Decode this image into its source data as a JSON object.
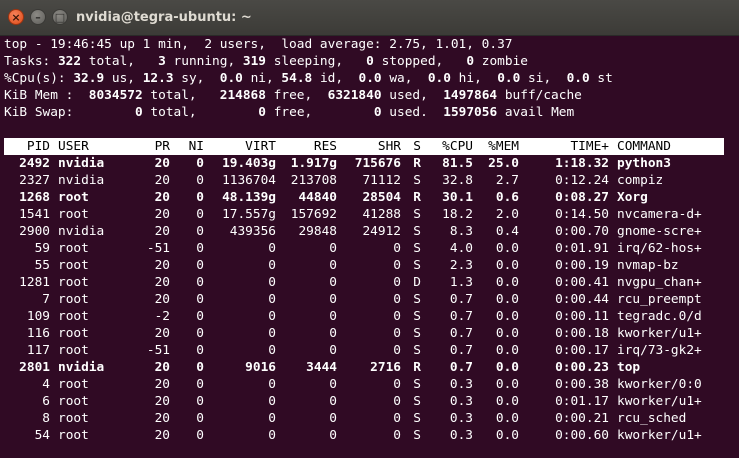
{
  "window": {
    "title": "nvidia@tegra-ubuntu: ~",
    "close_glyph": "×",
    "min_glyph": "–",
    "max_glyph": "□"
  },
  "colors": {
    "terminal_bg": "#300a24",
    "terminal_fg": "#ffffff",
    "close_button": "#df4a16"
  },
  "summary": {
    "line1": "top - 19:46:45 up 1 min,  2 users,  load average: 2.75, 1.01, 0.37",
    "tasks": [
      {
        "t": "Tasks: ",
        "b": false
      },
      {
        "t": "322",
        "b": true
      },
      {
        "t": " total,   ",
        "b": false
      },
      {
        "t": "3",
        "b": true
      },
      {
        "t": " running, ",
        "b": false
      },
      {
        "t": "319",
        "b": true
      },
      {
        "t": " sleeping,   ",
        "b": false
      },
      {
        "t": "0",
        "b": true
      },
      {
        "t": " stopped,   ",
        "b": false
      },
      {
        "t": "0",
        "b": true
      },
      {
        "t": " zombie",
        "b": false
      }
    ],
    "cpu": [
      {
        "t": "%Cpu(s): ",
        "b": false
      },
      {
        "t": "32.9",
        "b": true
      },
      {
        "t": " us, ",
        "b": false
      },
      {
        "t": "12.3",
        "b": true
      },
      {
        "t": " sy,  ",
        "b": false
      },
      {
        "t": "0.0",
        "b": true
      },
      {
        "t": " ni, ",
        "b": false
      },
      {
        "t": "54.8",
        "b": true
      },
      {
        "t": " id,  ",
        "b": false
      },
      {
        "t": "0.0",
        "b": true
      },
      {
        "t": " wa,  ",
        "b": false
      },
      {
        "t": "0.0",
        "b": true
      },
      {
        "t": " hi,  ",
        "b": false
      },
      {
        "t": "0.0",
        "b": true
      },
      {
        "t": " si,  ",
        "b": false
      },
      {
        "t": "0.0",
        "b": true
      },
      {
        "t": " st",
        "b": false
      }
    ],
    "mem": [
      {
        "t": "KiB Mem :  ",
        "b": false
      },
      {
        "t": "8034572",
        "b": true
      },
      {
        "t": " total,   ",
        "b": false
      },
      {
        "t": "214868",
        "b": true
      },
      {
        "t": " free,  ",
        "b": false
      },
      {
        "t": "6321840",
        "b": true
      },
      {
        "t": " used,  ",
        "b": false
      },
      {
        "t": "1497864",
        "b": true
      },
      {
        "t": " buff/cache",
        "b": false
      }
    ],
    "swap": [
      {
        "t": "KiB Swap:        ",
        "b": false
      },
      {
        "t": "0",
        "b": true
      },
      {
        "t": " total,        ",
        "b": false
      },
      {
        "t": "0",
        "b": true
      },
      {
        "t": " free,        ",
        "b": false
      },
      {
        "t": "0",
        "b": true
      },
      {
        "t": " used.  ",
        "b": false
      },
      {
        "t": "1597056",
        "b": true
      },
      {
        "t": " avail Mem",
        "b": false
      }
    ]
  },
  "columns": [
    "PID",
    "USER",
    "PR",
    "NI",
    "VIRT",
    "RES",
    "SHR",
    "S",
    "%CPU",
    "%MEM",
    "TIME+",
    "COMMAND"
  ],
  "processes": [
    {
      "pid": "2492",
      "user": "nvidia",
      "pr": "20",
      "ni": "0",
      "virt": "19.403g",
      "res": "1.917g",
      "shr": "715676",
      "s": "R",
      "cpu": "81.5",
      "mem": "25.0",
      "time": "1:18.32",
      "cmd": "python3",
      "bold": true
    },
    {
      "pid": "2327",
      "user": "nvidia",
      "pr": "20",
      "ni": "0",
      "virt": "1136704",
      "res": "213708",
      "shr": "71112",
      "s": "S",
      "cpu": "32.8",
      "mem": "2.7",
      "time": "0:12.24",
      "cmd": "compiz",
      "bold": false
    },
    {
      "pid": "1268",
      "user": "root",
      "pr": "20",
      "ni": "0",
      "virt": "48.139g",
      "res": "44840",
      "shr": "28504",
      "s": "R",
      "cpu": "30.1",
      "mem": "0.6",
      "time": "0:08.27",
      "cmd": "Xorg",
      "bold": true
    },
    {
      "pid": "1541",
      "user": "root",
      "pr": "20",
      "ni": "0",
      "virt": "17.557g",
      "res": "157692",
      "shr": "41288",
      "s": "S",
      "cpu": "18.2",
      "mem": "2.0",
      "time": "0:14.50",
      "cmd": "nvcamera-d+",
      "bold": false
    },
    {
      "pid": "2900",
      "user": "nvidia",
      "pr": "20",
      "ni": "0",
      "virt": "439356",
      "res": "29848",
      "shr": "24912",
      "s": "S",
      "cpu": "8.3",
      "mem": "0.4",
      "time": "0:00.70",
      "cmd": "gnome-scre+",
      "bold": false
    },
    {
      "pid": "59",
      "user": "root",
      "pr": "-51",
      "ni": "0",
      "virt": "0",
      "res": "0",
      "shr": "0",
      "s": "S",
      "cpu": "4.0",
      "mem": "0.0",
      "time": "0:01.91",
      "cmd": "irq/62-hos+",
      "bold": false
    },
    {
      "pid": "55",
      "user": "root",
      "pr": "20",
      "ni": "0",
      "virt": "0",
      "res": "0",
      "shr": "0",
      "s": "S",
      "cpu": "2.3",
      "mem": "0.0",
      "time": "0:00.19",
      "cmd": "nvmap-bz",
      "bold": false
    },
    {
      "pid": "1281",
      "user": "root",
      "pr": "20",
      "ni": "0",
      "virt": "0",
      "res": "0",
      "shr": "0",
      "s": "D",
      "cpu": "1.3",
      "mem": "0.0",
      "time": "0:00.41",
      "cmd": "nvgpu_chan+",
      "bold": false
    },
    {
      "pid": "7",
      "user": "root",
      "pr": "20",
      "ni": "0",
      "virt": "0",
      "res": "0",
      "shr": "0",
      "s": "S",
      "cpu": "0.7",
      "mem": "0.0",
      "time": "0:00.44",
      "cmd": "rcu_preempt",
      "bold": false
    },
    {
      "pid": "109",
      "user": "root",
      "pr": "-2",
      "ni": "0",
      "virt": "0",
      "res": "0",
      "shr": "0",
      "s": "S",
      "cpu": "0.7",
      "mem": "0.0",
      "time": "0:00.11",
      "cmd": "tegradc.0/d",
      "bold": false
    },
    {
      "pid": "116",
      "user": "root",
      "pr": "20",
      "ni": "0",
      "virt": "0",
      "res": "0",
      "shr": "0",
      "s": "S",
      "cpu": "0.7",
      "mem": "0.0",
      "time": "0:00.18",
      "cmd": "kworker/u1+",
      "bold": false
    },
    {
      "pid": "117",
      "user": "root",
      "pr": "-51",
      "ni": "0",
      "virt": "0",
      "res": "0",
      "shr": "0",
      "s": "S",
      "cpu": "0.7",
      "mem": "0.0",
      "time": "0:00.17",
      "cmd": "irq/73-gk2+",
      "bold": false
    },
    {
      "pid": "2801",
      "user": "nvidia",
      "pr": "20",
      "ni": "0",
      "virt": "9016",
      "res": "3444",
      "shr": "2716",
      "s": "R",
      "cpu": "0.7",
      "mem": "0.0",
      "time": "0:00.23",
      "cmd": "top",
      "bold": true
    },
    {
      "pid": "4",
      "user": "root",
      "pr": "20",
      "ni": "0",
      "virt": "0",
      "res": "0",
      "shr": "0",
      "s": "S",
      "cpu": "0.3",
      "mem": "0.0",
      "time": "0:00.38",
      "cmd": "kworker/0:0",
      "bold": false
    },
    {
      "pid": "6",
      "user": "root",
      "pr": "20",
      "ni": "0",
      "virt": "0",
      "res": "0",
      "shr": "0",
      "s": "S",
      "cpu": "0.3",
      "mem": "0.0",
      "time": "0:01.17",
      "cmd": "kworker/u1+",
      "bold": false
    },
    {
      "pid": "8",
      "user": "root",
      "pr": "20",
      "ni": "0",
      "virt": "0",
      "res": "0",
      "shr": "0",
      "s": "S",
      "cpu": "0.3",
      "mem": "0.0",
      "time": "0:00.21",
      "cmd": "rcu_sched",
      "bold": false
    },
    {
      "pid": "54",
      "user": "root",
      "pr": "20",
      "ni": "0",
      "virt": "0",
      "res": "0",
      "shr": "0",
      "s": "S",
      "cpu": "0.3",
      "mem": "0.0",
      "time": "0:00.60",
      "cmd": "kworker/u1+",
      "bold": false
    }
  ]
}
